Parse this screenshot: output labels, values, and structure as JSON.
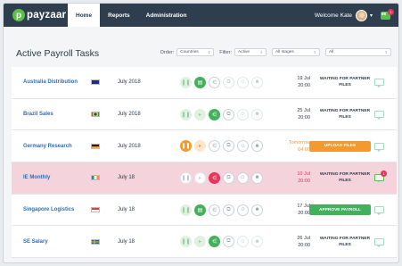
{
  "navbar": {
    "logo_mark": "p",
    "logo_text": "payzaar",
    "tabs": [
      {
        "label": "Home",
        "active": true
      },
      {
        "label": "Reports",
        "active": false
      },
      {
        "label": "Administration",
        "active": false
      }
    ],
    "welcome": "Welcome Kate",
    "notifications": {
      "count": "98",
      "badge": "1"
    }
  },
  "page": {
    "title": "Active Payroll Tasks",
    "filters": {
      "order_label": "Order:",
      "order_value": "Countries",
      "filter_label": "Filter:",
      "filter_value": "Active",
      "stages_value": "All stages",
      "all_value": "All"
    }
  },
  "rows": [
    {
      "name": "Australia Distribution",
      "flag": "AU",
      "period": "July 2018",
      "due_date": "19 Jul",
      "due_time": "20:00",
      "status": "WAITING FOR PARTNER FILES",
      "status_type": "text",
      "comment_badge": ""
    },
    {
      "name": "Brazil Sales",
      "flag": "BR",
      "period": "July 2018",
      "due_date": "25 Jul",
      "due_time": "20:00",
      "status": "WAITING FOR PARTNER FILES",
      "status_type": "text",
      "comment_badge": ""
    },
    {
      "name": "Germany Research",
      "flag": "DE",
      "period": "July 2018",
      "due_date": "Tomorrow",
      "due_time": "04:00",
      "status": "UPLOAD FILES",
      "status_type": "orange-button",
      "comment_badge": ""
    },
    {
      "name": "IE Monthly",
      "flag": "IE",
      "period": "July 18",
      "due_date": "10 Jul",
      "due_time": "20:00",
      "status": "WAITING FOR PARTNER FILES",
      "status_type": "text",
      "comment_badge": "1"
    },
    {
      "name": "Singapore Logistics",
      "flag": "SG",
      "period": "July 18",
      "due_date": "17 Jul",
      "due_time": "20:00",
      "status": "APPROVE PAYROLL",
      "status_type": "green-button",
      "comment_badge": ""
    },
    {
      "name": "SE Salary",
      "flag": "SE",
      "period": "July 18",
      "due_date": "26 Jul",
      "due_time": "20:00",
      "status": "WAITING FOR PARTNER FILES",
      "status_type": "text",
      "comment_badge": ""
    }
  ],
  "colors": {
    "navbar": "#2f3e4e",
    "brand_green": "#43b05c",
    "accent_orange": "#f39a2f",
    "alert_pink": "#e8335a",
    "highlight_row": "#f5d3dc",
    "link_blue": "#2f6fb3"
  },
  "icons": [
    "pause-icon",
    "document-icon",
    "share-icon",
    "copy-icon",
    "people-icon",
    "user-group-icon",
    "comment-icon"
  ]
}
